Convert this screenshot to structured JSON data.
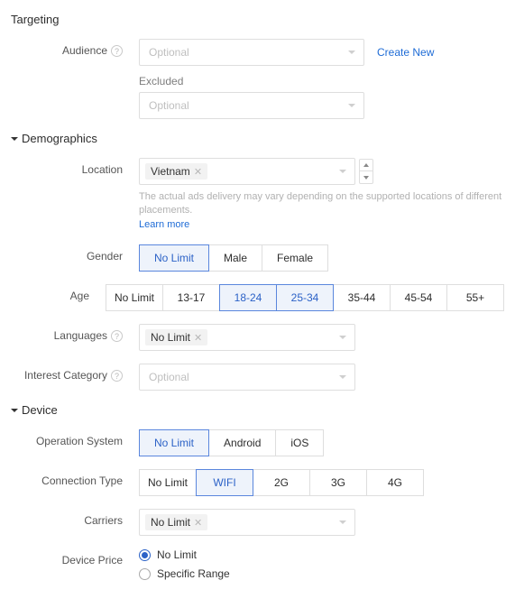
{
  "targeting": {
    "title": "Targeting",
    "audience_label": "Audience",
    "audience_placeholder": "Optional",
    "create_link": "Create New",
    "excluded_label": "Excluded",
    "excluded_placeholder": "Optional"
  },
  "demographics": {
    "title": "Demographics",
    "location_label": "Location",
    "location_tag": "Vietnam",
    "location_note": "The actual ads delivery may vary depending on the supported locations of different placements.",
    "learn_more": "Learn more",
    "gender_label": "Gender",
    "gender_options": [
      "No Limit",
      "Male",
      "Female"
    ],
    "gender_selected": 0,
    "age_label": "Age",
    "age_options": [
      "No Limit",
      "13-17",
      "18-24",
      "25-34",
      "35-44",
      "45-54",
      "55+"
    ],
    "age_selected": [
      2,
      3
    ],
    "languages_label": "Languages",
    "languages_tag": "No Limit",
    "interest_label": "Interest Category",
    "interest_placeholder": "Optional"
  },
  "device": {
    "title": "Device",
    "os_label": "Operation System",
    "os_options": [
      "No Limit",
      "Android",
      "iOS"
    ],
    "os_selected": 0,
    "conn_label": "Connection Type",
    "conn_options": [
      "No Limit",
      "WIFI",
      "2G",
      "3G",
      "4G"
    ],
    "conn_selected": [
      1
    ],
    "carriers_label": "Carriers",
    "carriers_tag": "No Limit",
    "price_label": "Device Price",
    "price_options": [
      "No Limit",
      "Specific Range"
    ],
    "price_selected": 0
  }
}
